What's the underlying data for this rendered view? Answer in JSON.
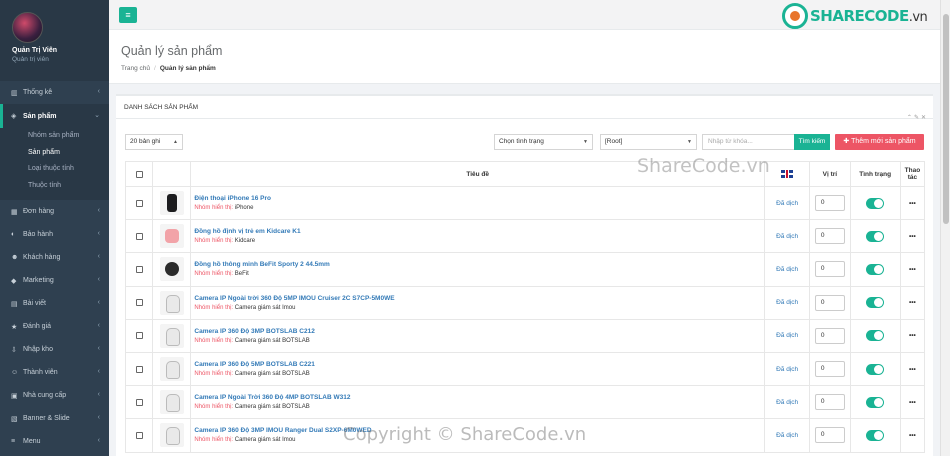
{
  "sidebar": {
    "user_name": "Quản Trị Viên",
    "user_role": "Quản trị viên",
    "items": [
      {
        "label": "Thống kê",
        "icon": "chart-icon"
      },
      {
        "label": "Sản phẩm",
        "icon": "box-icon",
        "active": true
      },
      {
        "label": "Đơn hàng",
        "icon": "cart-icon"
      },
      {
        "label": "Bảo hành",
        "icon": "shield-icon"
      },
      {
        "label": "Khách hàng",
        "icon": "users-icon"
      },
      {
        "label": "Marketing",
        "icon": "bullhorn-icon"
      },
      {
        "label": "Bài viết",
        "icon": "file-icon"
      },
      {
        "label": "Đánh giá",
        "icon": "star-icon"
      },
      {
        "label": "Nhập kho",
        "icon": "import-icon"
      },
      {
        "label": "Thành viên",
        "icon": "user-icon"
      },
      {
        "label": "Nhà cung cấp",
        "icon": "truck-icon"
      },
      {
        "label": "Banner & Slide",
        "icon": "image-icon"
      },
      {
        "label": "Menu",
        "icon": "menu-icon"
      }
    ],
    "subitems": [
      "Nhóm sản phẩm",
      "Sản phẩm",
      "Loại thuộc tính",
      "Thuộc tính"
    ]
  },
  "header": {
    "logo_main": "SHARECODE",
    "logo_tld": ".vn"
  },
  "page": {
    "title": "Quản lý sản phẩm",
    "breadcrumb_home": "Trang chủ",
    "breadcrumb_current": "Quản lý sản phẩm"
  },
  "panel": {
    "title": "DANH SÁCH SẢN PHẨM"
  },
  "filters": {
    "page_size": "20 bản ghi",
    "status": "Chọn tình trạng",
    "category": "[Root]",
    "keyword_placeholder": "Nhập từ khóa...",
    "search_label": "Tìm kiếm",
    "add_label": "Thêm mới sản phẩm"
  },
  "table": {
    "headers": {
      "title": "Tiêu đề",
      "position": "Vị trí",
      "status": "Tình trạng",
      "actions_line1": "Thao",
      "actions_line2": "tác"
    },
    "group_label": "Nhóm hiển thị:",
    "rows": [
      {
        "name": "Điện thoại iPhone 16 Pro",
        "group": "iPhone",
        "translation": "Đã dịch",
        "position": "0",
        "active": true,
        "thumb": "t-phone"
      },
      {
        "name": "Đồng hồ định vị trẻ em Kidcare K1",
        "group": "Kidcare",
        "translation": "Đã dịch",
        "position": "0",
        "active": true,
        "thumb": "t-kid"
      },
      {
        "name": "Đồng hồ thông minh BeFit Sporty 2 44.5mm",
        "group": "BeFit",
        "translation": "Đã dịch",
        "position": "0",
        "active": true,
        "thumb": "t-watch"
      },
      {
        "name": "Camera IP Ngoài trời 360 Độ 5MP IMOU Cruiser 2C S7CP-5M0WE",
        "group": "Camera giám sát Imou",
        "translation": "Đã dịch",
        "position": "0",
        "active": true,
        "thumb": "t-cam"
      },
      {
        "name": "Camera IP 360 Độ 3MP BOTSLAB C212",
        "group": "Camera giám sát BOTSLAB",
        "translation": "Đã dịch",
        "position": "0",
        "active": true,
        "thumb": "t-cam"
      },
      {
        "name": "Camera IP 360 Độ 5MP BOTSLAB C221",
        "group": "Camera giám sát BOTSLAB",
        "translation": "Đã dịch",
        "position": "0",
        "active": true,
        "thumb": "t-cam"
      },
      {
        "name": "Camera IP Ngoài Trời 360 Độ 4MP BOTSLAB W312",
        "group": "Camera giám sát BOTSLAB",
        "translation": "Đã dịch",
        "position": "0",
        "active": true,
        "thumb": "t-cam"
      },
      {
        "name": "Camera IP 360 Độ 3MP IMOU Ranger Dual S2XP-6M0WED",
        "group": "Camera giám sát Imou",
        "translation": "Đã dịch",
        "position": "0",
        "active": true,
        "thumb": "t-cam"
      }
    ]
  },
  "watermarks": {
    "center": "ShareCode.vn",
    "bottom": "Copyright © ShareCode.vn"
  }
}
